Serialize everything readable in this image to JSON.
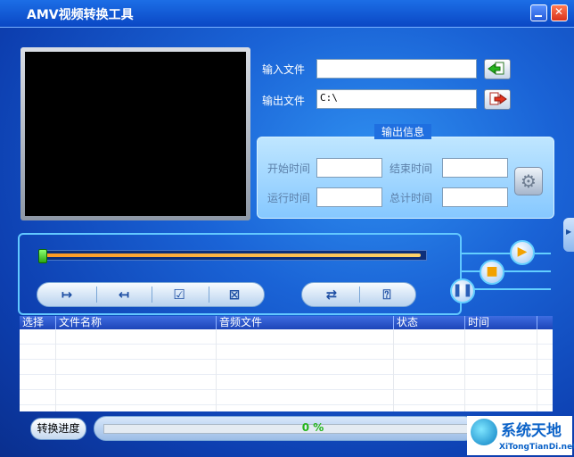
{
  "window": {
    "title": "AMV视频转换工具"
  },
  "io": {
    "input_label": "输入文件",
    "input_value": "",
    "output_label": "输出文件",
    "output_value": "C:\\"
  },
  "info": {
    "title": "输出信息",
    "start_label": "开始时间",
    "end_label": "结束时间",
    "run_label": "运行时间",
    "total_label": "总计时间",
    "start_value": "",
    "end_value": "",
    "run_value": "",
    "total_value": ""
  },
  "seek": {
    "position_fraction": 0.0
  },
  "table": {
    "columns": [
      "选择",
      "文件名称",
      "音频文件",
      "状态",
      "时间"
    ],
    "rows": []
  },
  "footer": {
    "convert_label": "转换进度",
    "progress_text": "0 %",
    "progress_fraction": 0.0
  },
  "watermark": {
    "main": "系统天地",
    "sub": "XiTongTianDi.net"
  },
  "colors": {
    "accent": "#1a63d6",
    "progress_text": "#23b51c"
  },
  "icons": [
    "minimize-icon",
    "close-icon",
    "import-file-icon",
    "export-file-icon",
    "settings-gear-icon",
    "add-start-icon",
    "add-end-icon",
    "check-icon",
    "delete-icon",
    "convert-icon",
    "help-icon",
    "play-icon",
    "stop-icon",
    "pause-icon"
  ]
}
